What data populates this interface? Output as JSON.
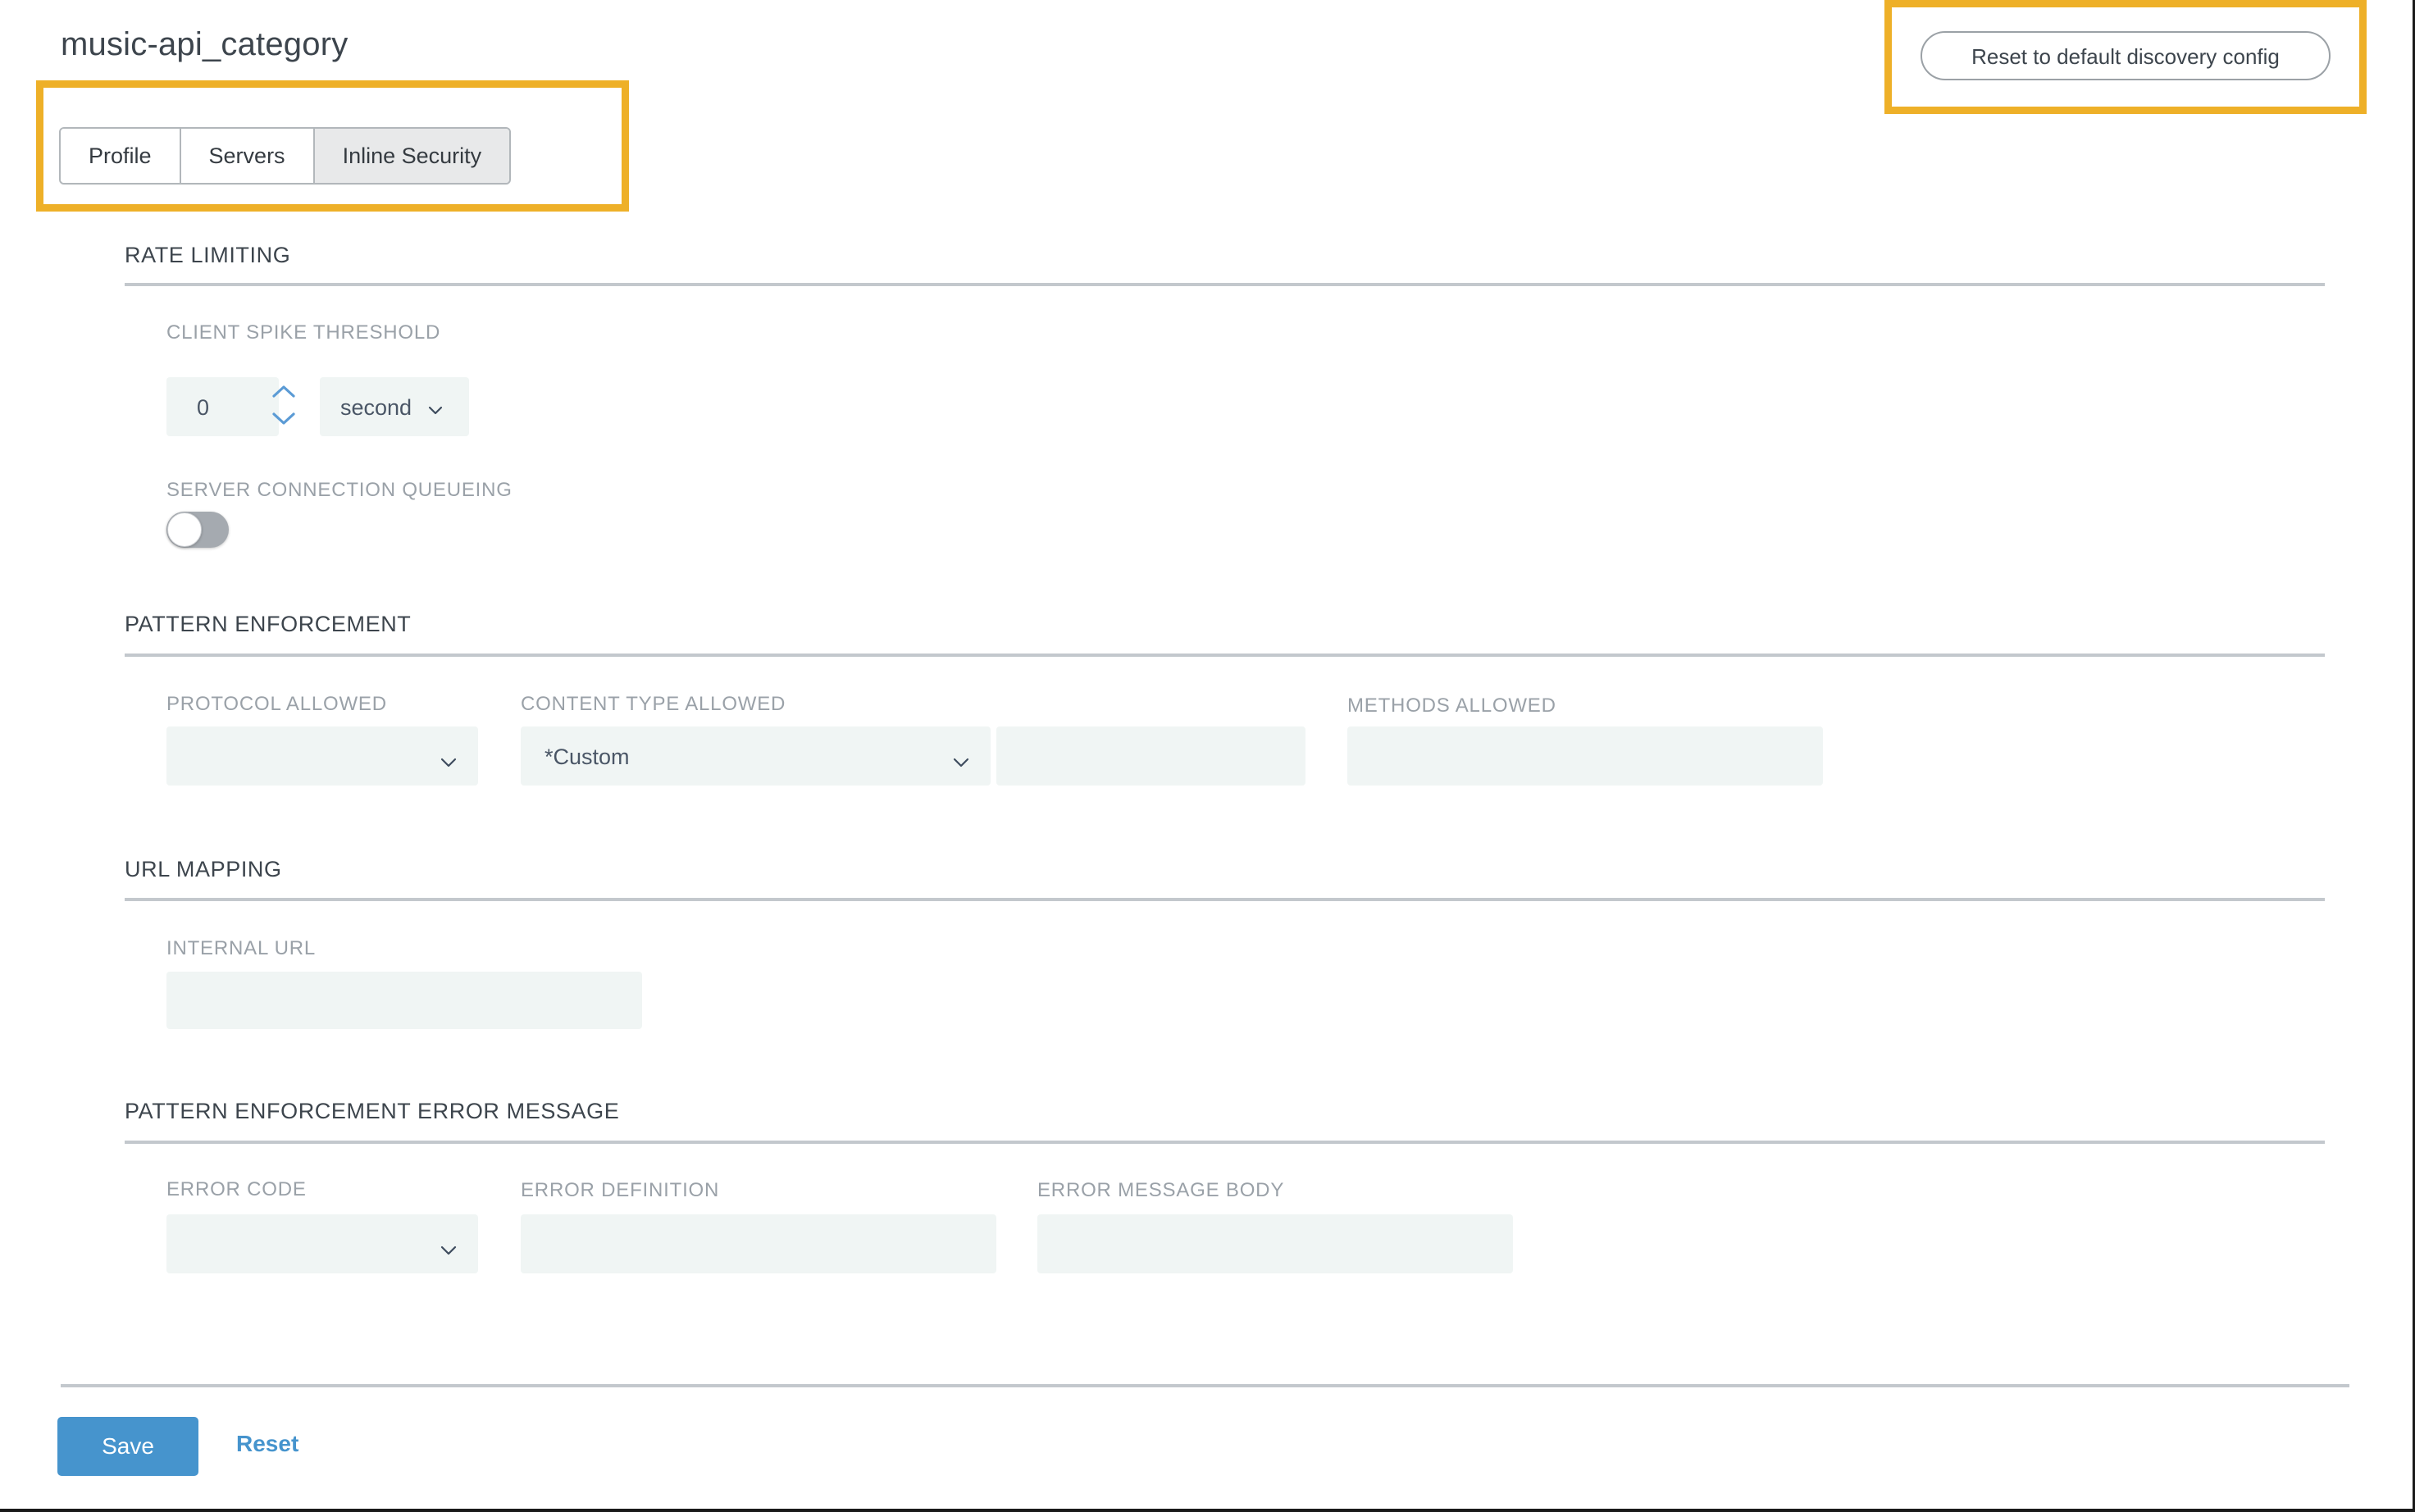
{
  "page_title": "music-api_category",
  "header": {
    "reset_discovery_label": "Reset to default discovery config"
  },
  "tabs": [
    {
      "label": "Profile",
      "active": false
    },
    {
      "label": "Servers",
      "active": false
    },
    {
      "label": "Inline Security",
      "active": true
    }
  ],
  "sections": {
    "rate_limiting": {
      "title": "RATE LIMITING",
      "client_spike_threshold": {
        "label": "CLIENT SPIKE THRESHOLD",
        "value": "0",
        "unit": "second"
      },
      "server_connection_queueing": {
        "label": "SERVER CONNECTION QUEUEING",
        "enabled": false
      }
    },
    "pattern_enforcement": {
      "title": "PATTERN ENFORCEMENT",
      "protocol_allowed": {
        "label": "PROTOCOL ALLOWED",
        "value": ""
      },
      "content_type_allowed": {
        "label": "CONTENT TYPE ALLOWED",
        "value": "*Custom",
        "extra_value": ""
      },
      "methods_allowed": {
        "label": "METHODS ALLOWED",
        "value": ""
      }
    },
    "url_mapping": {
      "title": "URL MAPPING",
      "internal_url": {
        "label": "INTERNAL URL",
        "value": ""
      }
    },
    "pattern_enforcement_error_message": {
      "title": "PATTERN ENFORCEMENT ERROR MESSAGE",
      "error_code": {
        "label": "ERROR CODE",
        "value": ""
      },
      "error_definition": {
        "label": "ERROR DEFINITION",
        "value": ""
      },
      "error_message_body": {
        "label": "ERROR MESSAGE BODY",
        "value": ""
      }
    }
  },
  "footer": {
    "save_label": "Save",
    "reset_label": "Reset"
  },
  "colors": {
    "highlight": "#eeb028",
    "primary_button": "#4694cd",
    "input_background": "#f0f5f4",
    "active_tab_background": "#e8e9ea",
    "toggle_off": "#a5aab0",
    "rule": "#c3c8cd"
  }
}
